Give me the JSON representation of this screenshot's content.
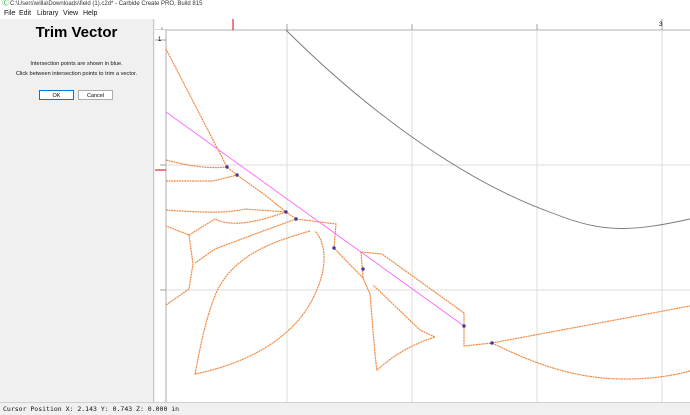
{
  "window": {
    "title": "C:\\Users\\willa\\Downloads\\field (1).c2d* - Carbide Create PRO, Build 815"
  },
  "menu": [
    {
      "label": "File"
    },
    {
      "label": "Edit"
    },
    {
      "label": "Library"
    },
    {
      "label": "View"
    },
    {
      "label": "Help"
    }
  ],
  "panel": {
    "title": "Trim Vector",
    "instruction_1": "Intersection points are shown in blue.",
    "instruction_2": "Click between intersection points to trim a vector.",
    "ok_label": "OK",
    "cancel_label": "Cancel"
  },
  "canvas": {
    "ruler_label_top": "3",
    "ruler_label_left": "1"
  },
  "status": {
    "cursor_position": "Cursor Position X: 2.143 Y: 0.743 Z: 0.000 in"
  },
  "colors": {
    "vector": "#f08a45",
    "trim_line": "#ff66ff",
    "intersection": "#3a3aa0",
    "grid": "#dcdcdc",
    "arc": "#777777"
  }
}
